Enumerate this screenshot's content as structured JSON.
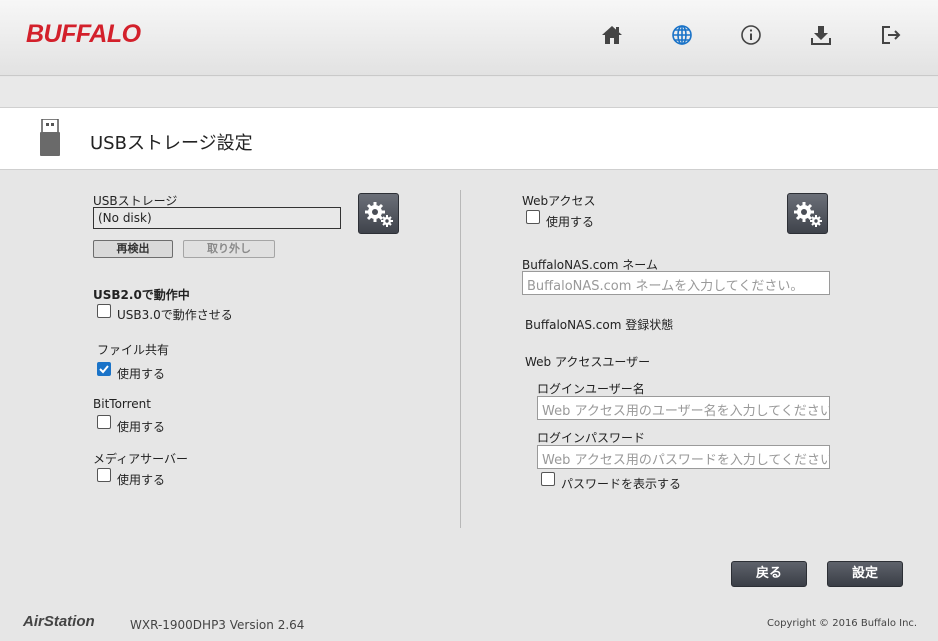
{
  "header": {
    "logo": "BUFFALO",
    "colors": {
      "brand": "#d3202b",
      "accent": "#1a73c8",
      "icon": "#444444"
    },
    "nav_icons": [
      "home-icon",
      "globe-icon",
      "info-icon",
      "download-icon",
      "logout-icon"
    ]
  },
  "page": {
    "title": "USBストレージ設定"
  },
  "left": {
    "usb_storage_label": "USBストレージ",
    "usb_storage_value": "(No disk)",
    "rescan_label": "再検出",
    "remove_label": "取り外し",
    "usb_mode_label": "USB2.0で動作中",
    "usb3_label": "USB3.0で動作させる",
    "usb3_checked": false,
    "file_share_label": "ファイル共有",
    "file_share_use": "使用する",
    "file_share_checked": true,
    "bittorrent_label": "BitTorrent",
    "bittorrent_use": "使用する",
    "bittorrent_checked": false,
    "media_server_label": "メディアサーバー",
    "media_server_use": "使用する",
    "media_server_checked": false
  },
  "right": {
    "web_access_label": "Webアクセス",
    "web_access_use": "使用する",
    "web_access_checked": false,
    "nas_name_label": "BuffaloNAS.com ネーム",
    "nas_name_placeholder": "BuffaloNAS.com ネームを入力してください。",
    "nas_status_label": "BuffaloNAS.com 登録状態",
    "web_user_label": "Web アクセスユーザー",
    "login_user_label": "ログインユーザー名",
    "login_user_placeholder": "Web アクセス用のユーザー名を入力してください。",
    "login_pass_label": "ログインパスワード",
    "login_pass_placeholder": "Web アクセス用のパスワードを入力してください。",
    "show_password_label": "パスワードを表示する",
    "show_password_checked": false
  },
  "actions": {
    "back_label": "戻る",
    "apply_label": "設定"
  },
  "footer": {
    "brand": "AirStation",
    "model": "WXR-1900DHP3   Version 2.64",
    "copyright": "Copyright © 2016 Buffalo Inc."
  }
}
